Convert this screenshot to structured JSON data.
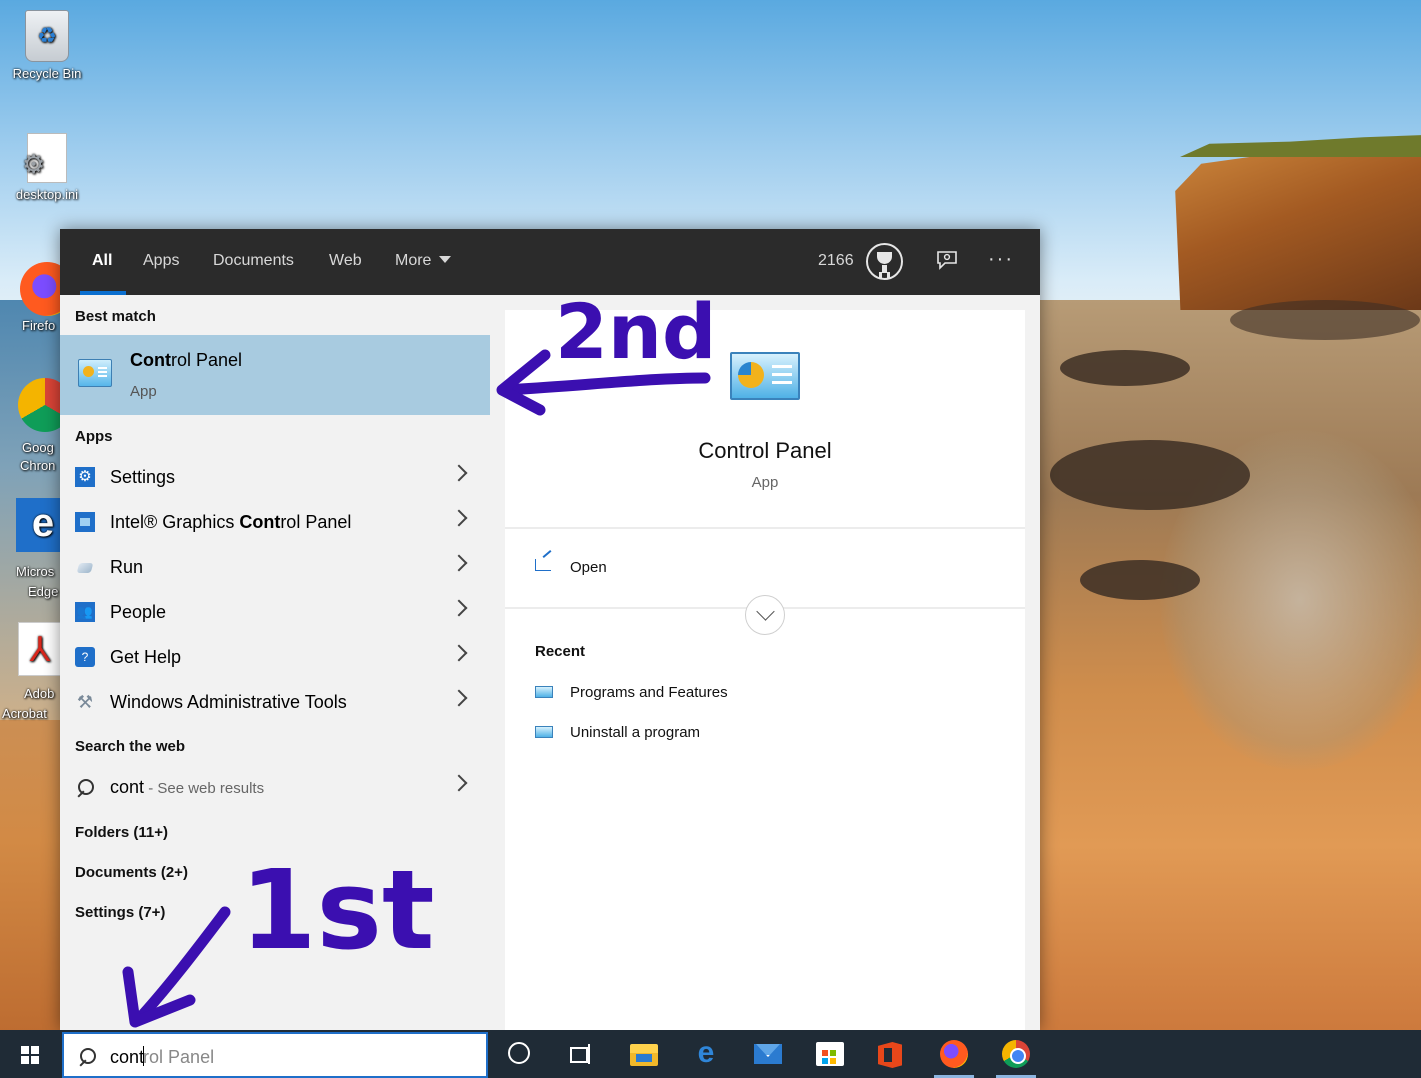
{
  "desktop": {
    "icons": [
      {
        "label": "Recycle Bin"
      },
      {
        "label": "desktop.ini"
      }
    ],
    "partial_icons": [
      {
        "label": "Firefo"
      },
      {
        "label": "Goog",
        "label2": "Chron"
      },
      {
        "label": "Micros",
        "label2": "Edge"
      },
      {
        "label": "Adob",
        "label2": "Acrobat"
      }
    ]
  },
  "search": {
    "tabs": [
      {
        "label": "All",
        "active": true
      },
      {
        "label": "Apps"
      },
      {
        "label": "Documents"
      },
      {
        "label": "Web"
      },
      {
        "label": "More"
      }
    ],
    "points": "2166",
    "more_options": "···",
    "best_match": {
      "heading": "Best match",
      "title_bold": "Cont",
      "title_bold2": "r",
      "title_rest": "ol Panel",
      "subtitle": "App"
    },
    "apps_heading": "Apps",
    "apps": [
      {
        "pre": "",
        "bold": "",
        "post": "Settings"
      },
      {
        "pre": "Intel® Graphics ",
        "bold": "Cont",
        "post": "rol Panel"
      },
      {
        "pre": "",
        "bold": "",
        "post": "Run"
      },
      {
        "pre": "",
        "bold": "",
        "post": "People"
      },
      {
        "pre": "",
        "bold": "",
        "post": "Get Help"
      },
      {
        "pre": "",
        "bold": "",
        "post": "Windows Administrative Tools"
      }
    ],
    "web_heading": "Search the web",
    "web_query": "cont",
    "web_hint": " - See web results",
    "categories": [
      "Folders (11+)",
      "Documents (2+)",
      "Settings (7+)"
    ],
    "preview": {
      "title": "Control Panel",
      "subtitle": "App",
      "open_label": "Open",
      "recent_heading": "Recent",
      "recent": [
        "Programs and Features",
        "Uninstall a program"
      ]
    }
  },
  "taskbar": {
    "search_typed": "cont",
    "search_suggest": "rol Panel"
  },
  "annotations": {
    "label_top": "2nd",
    "label_bottom": "1st",
    "ink_color": "#3b0fb0"
  }
}
